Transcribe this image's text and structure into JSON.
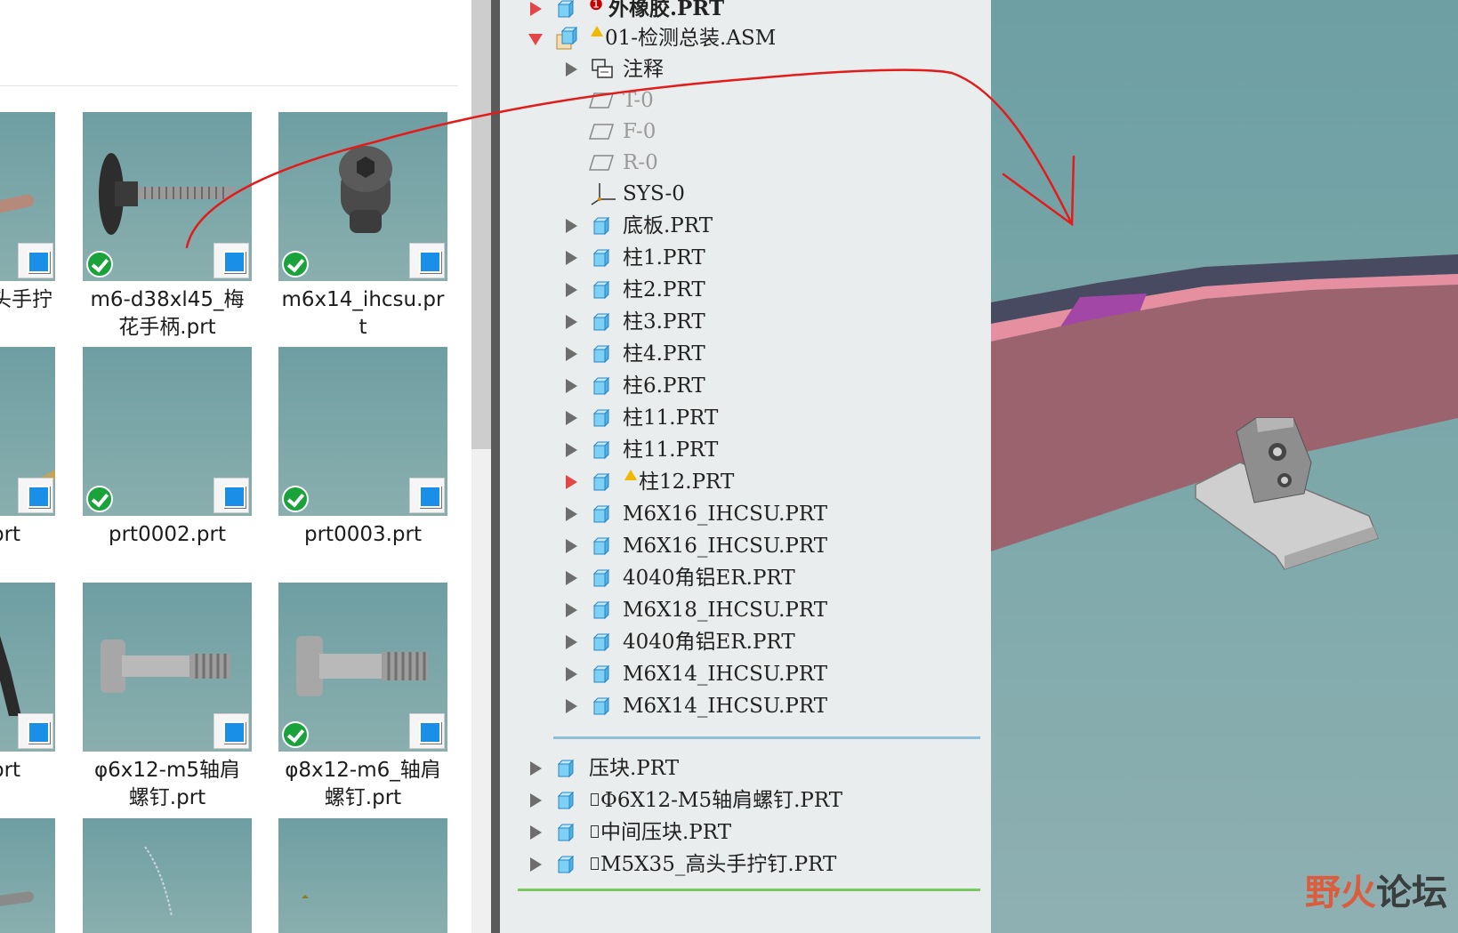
{
  "explorer": {
    "files": [
      {
        "label": "头手拧",
        "selected": false,
        "check": false,
        "partial": true
      },
      {
        "label": "m6-d38xl45_梅花手柄.prt",
        "line1": "m6-d38xl45_梅",
        "line2": "花手柄.prt",
        "check": true
      },
      {
        "label": "m6x14_ihcsu.prt",
        "line1": "m6x14_ihcsu.pr",
        "line2": "t",
        "check": true
      },
      {
        "label": "prt",
        "partial": true,
        "check": false
      },
      {
        "label": "prt0002.prt",
        "line1": "prt0002.prt",
        "line2": "",
        "check": true
      },
      {
        "label": "prt0003.prt",
        "line1": "prt0003.prt",
        "line2": "",
        "check": true
      },
      {
        "label": "prt",
        "partial": true,
        "check": false
      },
      {
        "label": "φ6x12-m5轴肩螺钉.prt",
        "line1": "φ6x12-m5轴肩",
        "line2": "螺钉.prt",
        "check": false
      },
      {
        "label": "φ8x12-m6_轴肩螺钉.prt",
        "line1": "φ8x12-m6_轴肩",
        "line2": "螺钉.prt",
        "check": true
      }
    ]
  },
  "tree": {
    "top_item": "外橡胶.PRT",
    "assembly": "01-检测总装.ASM",
    "annotation": "注释",
    "planes": [
      "T-0",
      "F-0",
      "R-0"
    ],
    "csys": "SYS-0",
    "parts": [
      "底板.PRT",
      "柱1.PRT",
      "柱2.PRT",
      "柱3.PRT",
      "柱4.PRT",
      "柱6.PRT",
      "柱11.PRT",
      "柱11.PRT",
      "柱12.PRT",
      "M6X16_IHCSU.PRT",
      "M6X16_IHCSU.PRT",
      "4040角铝ER.PRT",
      "M6X18_IHCSU.PRT",
      "4040角铝ER.PRT",
      "M6X14_IHCSU.PRT",
      "M6X14_IHCSU.PRT"
    ],
    "root_parts": [
      "压块.PRT",
      "Φ6X12-M5轴肩螺钉.PRT",
      "中间压块.PRT",
      "M5X35_高头手拧钉.PRT"
    ]
  },
  "viewport": {
    "watermark_part1": "野火",
    "watermark_part2": "论坛"
  },
  "colors": {
    "tree_bg": "#eaeded",
    "viewport_bg": "#7ca8aa",
    "part_pink": "#a8707a",
    "annotation_red": "#e21b1b",
    "check_green": "#1aa33b"
  }
}
